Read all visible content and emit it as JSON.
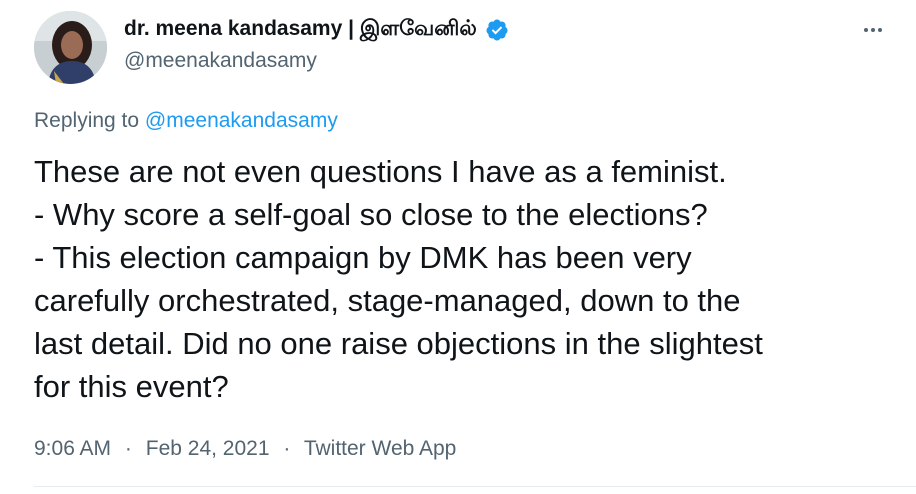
{
  "author": {
    "name": "dr. meena kandasamy | இளவேனில்",
    "handle": "@meenakandasamy",
    "verified": true
  },
  "reply": {
    "prefix": "Replying to",
    "to": "@meenakandasamy"
  },
  "tweet": {
    "lines": [
      "These are not even questions I have as a feminist.",
      "- Why score a self-goal so close to the elections?",
      "- This election campaign by DMK has been very",
      "carefully orchestrated, stage-managed, down to the",
      "last detail. Did no one raise objections in the slightest",
      "for this event?"
    ]
  },
  "meta": {
    "time": "9:06 AM",
    "date": "Feb 24, 2021",
    "separator": "·",
    "app": "Twitter Web App"
  },
  "colors": {
    "text": "#0f1419",
    "secondary": "#536471",
    "link": "#1d9bf0",
    "verified": "#1d9bf0"
  },
  "icons": {
    "verified": "verified-badge-icon",
    "more": "more-options-icon"
  }
}
